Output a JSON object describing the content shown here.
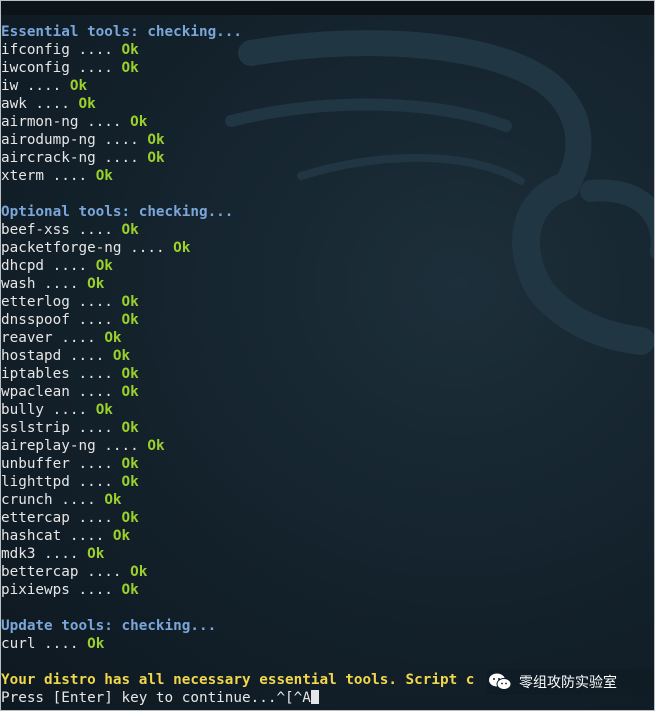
{
  "sections": [
    {
      "header": "Essential tools: checking...",
      "items": [
        {
          "name": "ifconfig",
          "status": "Ok"
        },
        {
          "name": "iwconfig",
          "status": "Ok"
        },
        {
          "name": "iw",
          "status": "Ok"
        },
        {
          "name": "awk",
          "status": "Ok"
        },
        {
          "name": "airmon-ng",
          "status": "Ok"
        },
        {
          "name": "airodump-ng",
          "status": "Ok"
        },
        {
          "name": "aircrack-ng",
          "status": "Ok"
        },
        {
          "name": "xterm",
          "status": "Ok"
        }
      ]
    },
    {
      "header": "Optional tools: checking...",
      "items": [
        {
          "name": "beef-xss",
          "status": "Ok"
        },
        {
          "name": "packetforge-ng",
          "status": "Ok"
        },
        {
          "name": "dhcpd",
          "status": "Ok"
        },
        {
          "name": "wash",
          "status": "Ok"
        },
        {
          "name": "etterlog",
          "status": "Ok"
        },
        {
          "name": "dnsspoof",
          "status": "Ok"
        },
        {
          "name": "reaver",
          "status": "Ok"
        },
        {
          "name": "hostapd",
          "status": "Ok"
        },
        {
          "name": "iptables",
          "status": "Ok"
        },
        {
          "name": "wpaclean",
          "status": "Ok"
        },
        {
          "name": "bully",
          "status": "Ok"
        },
        {
          "name": "sslstrip",
          "status": "Ok"
        },
        {
          "name": "aireplay-ng",
          "status": "Ok"
        },
        {
          "name": "unbuffer",
          "status": "Ok"
        },
        {
          "name": "lighttpd",
          "status": "Ok"
        },
        {
          "name": "crunch",
          "status": "Ok"
        },
        {
          "name": "ettercap",
          "status": "Ok"
        },
        {
          "name": "hashcat",
          "status": "Ok"
        },
        {
          "name": "mdk3",
          "status": "Ok"
        },
        {
          "name": "bettercap",
          "status": "Ok"
        },
        {
          "name": "pixiewps",
          "status": "Ok"
        }
      ]
    },
    {
      "header": "Update tools: checking...",
      "items": [
        {
          "name": "curl",
          "status": "Ok"
        }
      ]
    }
  ],
  "separator": " .... ",
  "final_message": "Your distro has all necessary essential tools. Script c",
  "prompt": "Press [Enter] key to continue...^[^A",
  "watermark": "零组攻防实验室",
  "watermark_icon": "wechat-icon",
  "colors": {
    "background": "#13212b",
    "header": "#7aa6da",
    "ok": "#9bd12b",
    "final": "#f0d84a",
    "text": "#e6e6e6"
  }
}
